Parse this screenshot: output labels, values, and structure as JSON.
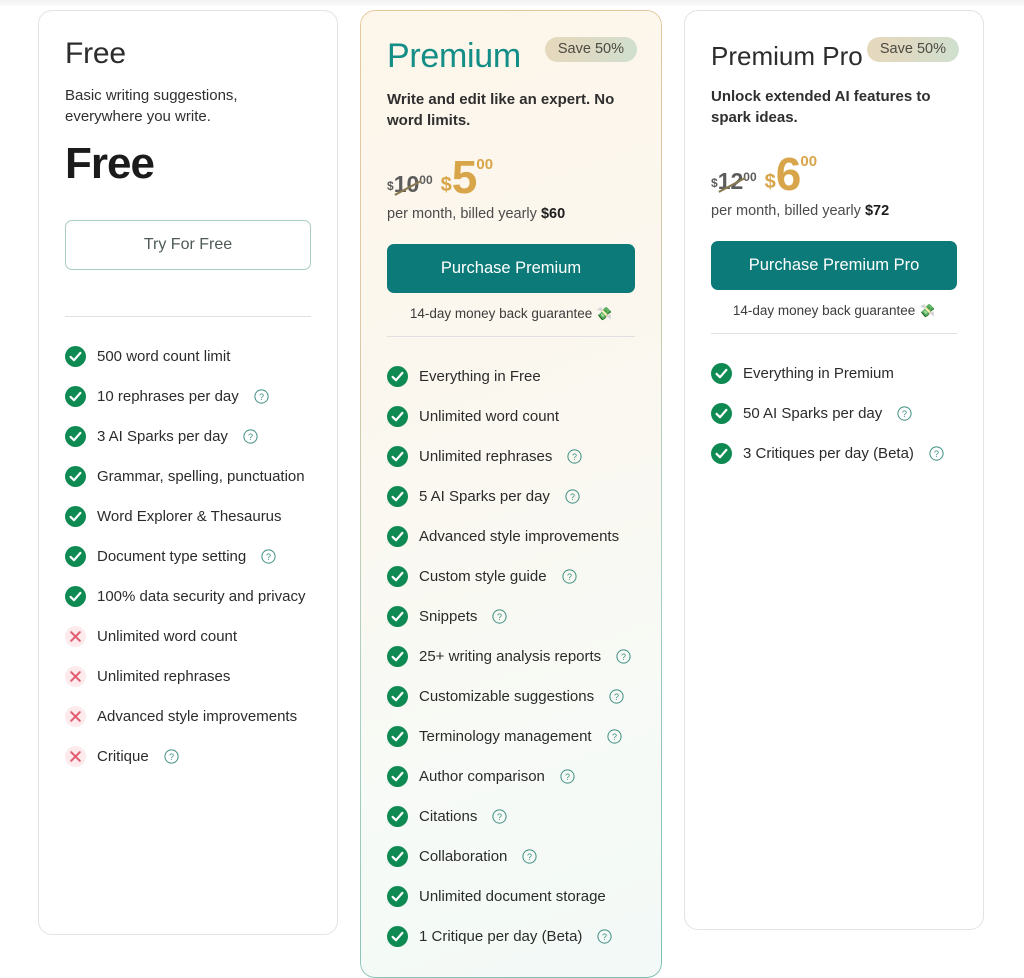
{
  "colors": {
    "accent_teal": "#0c7a78",
    "premium_title": "#138e87",
    "price_gold": "#d9a54a",
    "check_green": "#0f8a53",
    "cross_red": "#e05c6e",
    "badge_text": "#4d4a42"
  },
  "plans": [
    {
      "id": "free",
      "title": "Free",
      "description": "Basic writing suggestions, everywhere you write.",
      "price_display": "Free",
      "cta": "Try For Free",
      "features": [
        {
          "label": "500 word count limit",
          "status": "included",
          "help": false
        },
        {
          "label": "10 rephrases per day",
          "status": "included",
          "help": true
        },
        {
          "label": "3 AI Sparks per day",
          "status": "included",
          "help": true
        },
        {
          "label": "Grammar, spelling, punctuation",
          "status": "included",
          "help": false
        },
        {
          "label": "Word Explorer & Thesaurus",
          "status": "included",
          "help": false
        },
        {
          "label": "Document type setting",
          "status": "included",
          "help": true
        },
        {
          "label": "100% data security and privacy",
          "status": "included",
          "help": false
        },
        {
          "label": "Unlimited word count",
          "status": "excluded",
          "help": false
        },
        {
          "label": "Unlimited rephrases",
          "status": "excluded",
          "help": false
        },
        {
          "label": "Advanced style improvements",
          "status": "excluded",
          "help": false
        },
        {
          "label": "Critique",
          "status": "excluded",
          "help": true
        }
      ]
    },
    {
      "id": "premium",
      "badge": "Save 50%",
      "title": "Premium",
      "description": "Write and edit like an expert. No word limits.",
      "price_old_currency": "$",
      "price_old_amount": "10",
      "price_old_cents": "00",
      "price_new_currency": "$",
      "price_new_amount": "5",
      "price_new_cents": "00",
      "billing_note": "per month, billed yearly ",
      "billing_total": "$60",
      "cta": "Purchase Premium",
      "guarantee": "14-day money back guarantee ",
      "guarantee_emoji": "💸",
      "features": [
        {
          "label": "Everything in Free",
          "status": "included",
          "help": false
        },
        {
          "label": "Unlimited word count",
          "status": "included",
          "help": false
        },
        {
          "label": "Unlimited rephrases",
          "status": "included",
          "help": true
        },
        {
          "label": "5 AI Sparks per day",
          "status": "included",
          "help": true
        },
        {
          "label": "Advanced style improvements",
          "status": "included",
          "help": false
        },
        {
          "label": "Custom style guide",
          "status": "included",
          "help": true
        },
        {
          "label": "Snippets",
          "status": "included",
          "help": true
        },
        {
          "label": "25+ writing analysis reports",
          "status": "included",
          "help": true
        },
        {
          "label": "Customizable suggestions",
          "status": "included",
          "help": true
        },
        {
          "label": "Terminology management",
          "status": "included",
          "help": true
        },
        {
          "label": "Author comparison",
          "status": "included",
          "help": true
        },
        {
          "label": "Citations",
          "status": "included",
          "help": true
        },
        {
          "label": "Collaboration",
          "status": "included",
          "help": true
        },
        {
          "label": "Unlimited document storage",
          "status": "included",
          "help": false
        },
        {
          "label": "1 Critique per day (Beta)",
          "status": "included",
          "help": true
        }
      ]
    },
    {
      "id": "premium-pro",
      "badge": "Save 50%",
      "title": "Premium Pro",
      "description": "Unlock extended AI features to spark ideas.",
      "price_old_currency": "$",
      "price_old_amount": "12",
      "price_old_cents": "00",
      "price_new_currency": "$",
      "price_new_amount": "6",
      "price_new_cents": "00",
      "billing_note": "per month, billed yearly ",
      "billing_total": "$72",
      "cta": "Purchase Premium Pro",
      "guarantee": "14-day money back guarantee ",
      "guarantee_emoji": "💸",
      "features": [
        {
          "label": "Everything in Premium",
          "status": "included",
          "help": false
        },
        {
          "label": "50 AI Sparks per day",
          "status": "included",
          "help": true
        },
        {
          "label": "3 Critiques per day (Beta)",
          "status": "included",
          "help": true
        }
      ]
    }
  ]
}
